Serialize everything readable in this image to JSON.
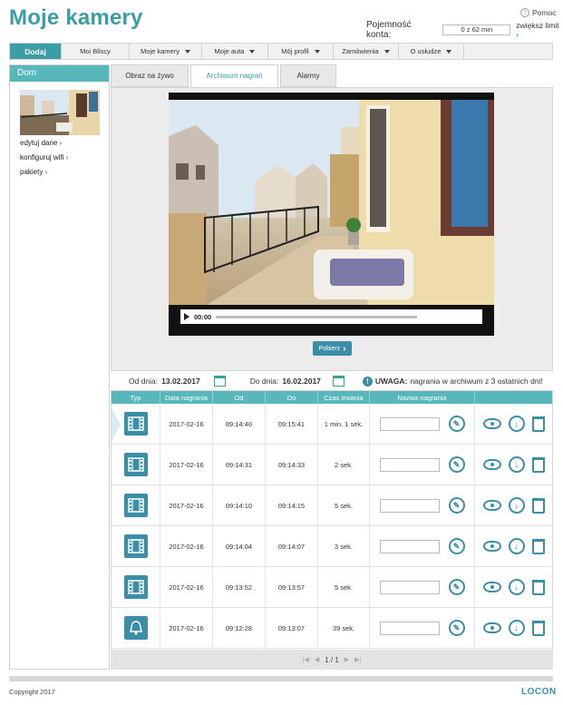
{
  "header": {
    "title": "Moje kamery",
    "help_label": "Pomoc",
    "account_label": "Pojemność konta:",
    "account_value": "0 z 62 min",
    "increase_label": "zwiększ limit"
  },
  "nav": {
    "items": [
      {
        "label": "Dodaj",
        "active": true,
        "dropdown": false
      },
      {
        "label": "Moi Bliscy",
        "active": false,
        "dropdown": false
      },
      {
        "label": "Moje kamery",
        "active": false,
        "dropdown": true
      },
      {
        "label": "Moje auta",
        "active": false,
        "dropdown": true
      },
      {
        "label": "Mój profil",
        "active": false,
        "dropdown": true
      },
      {
        "label": "Zamówienia",
        "active": false,
        "dropdown": true
      },
      {
        "label": "O usłudze",
        "active": false,
        "dropdown": true
      }
    ]
  },
  "sidebar": {
    "title": "Dom",
    "links": [
      "edytuj dane",
      "konfiguruj wifi",
      "pakiety"
    ]
  },
  "tabs": [
    {
      "label": "Obraz na żywo",
      "active": false
    },
    {
      "label": "Archiwum nagrań",
      "active": true
    },
    {
      "label": "Alarmy",
      "active": false
    }
  ],
  "player": {
    "time": "00:00"
  },
  "download_label": "Pobierz",
  "filters": {
    "from_label": "Od dnia:",
    "from_value": "13.02.2017",
    "to_label": "Do dnia:",
    "to_value": "16.02.2017",
    "warning_bold": "UWAGA:",
    "warning_text": "nagrania w archiwum z 3 ostatnich dni!"
  },
  "table": {
    "headers": [
      "Typ",
      "Data nagrania",
      "Od",
      "Do",
      "Czas trwania",
      "Nazwa nagrania",
      ""
    ],
    "rows": [
      {
        "type": "film-icon",
        "date": "2017-02-16",
        "from": "09:14:40",
        "to": "09:15:41",
        "duration": "1 min. 1 sek."
      },
      {
        "type": "film-icon",
        "date": "2017-02-16",
        "from": "09:14:31",
        "to": "09:14:33",
        "duration": "2 sek."
      },
      {
        "type": "film-icon",
        "date": "2017-02-16",
        "from": "09:14:10",
        "to": "09:14:15",
        "duration": "5 sek."
      },
      {
        "type": "film-icon",
        "date": "2017-02-16",
        "from": "09:14:04",
        "to": "09:14:07",
        "duration": "3 sek."
      },
      {
        "type": "film-icon",
        "date": "2017-02-16",
        "from": "09:13:52",
        "to": "09:13:57",
        "duration": "5 sek."
      },
      {
        "type": "bell-icon",
        "date": "2017-02-16",
        "from": "09:12:28",
        "to": "09:13:07",
        "duration": "39 sek."
      }
    ]
  },
  "pager": {
    "label": "1 / 1"
  },
  "footer": {
    "copyright": "Copyright 2017",
    "logo": "LOCON"
  },
  "colors": {
    "accent": "#3a9ea5",
    "button": "#3a8fa7",
    "table_header": "#58b7bb"
  }
}
